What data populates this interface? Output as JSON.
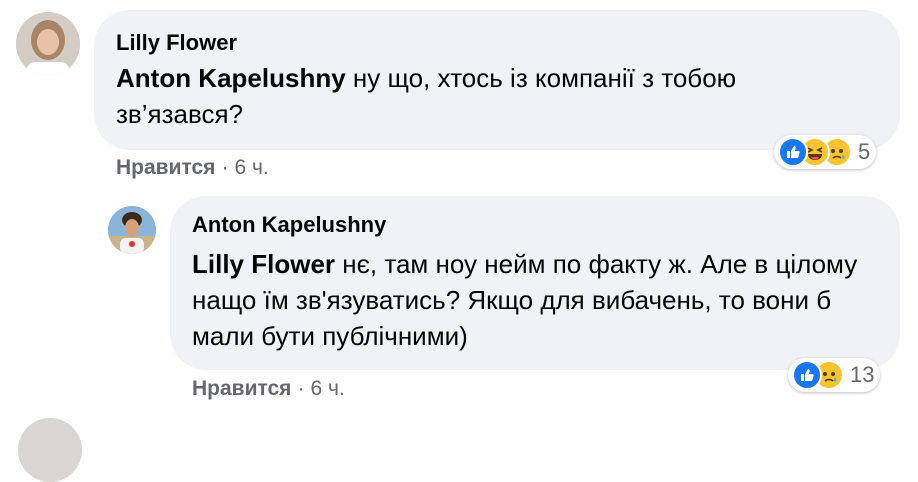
{
  "comment1": {
    "author": "Lilly Flower",
    "mention": "Anton Kapelushny",
    "text": " ну що, хтось із компанії з тобою зв’язався?",
    "like_label": "Нравится",
    "separator": "·",
    "time": "6 ч.",
    "reactions": [
      "like-icon",
      "haha-icon",
      "sad-icon"
    ],
    "reaction_count": "5"
  },
  "comment2": {
    "author": "Anton Kapelushny",
    "mention": "Lilly Flower",
    "text": " нє, там ноу нейм по факту ж. Але в цілому нащо їм зв'язуватись? Якщо для вибачень, то вони б мали бути публічними)",
    "like_label": "Нравится",
    "separator": "·",
    "time": "6 ч.",
    "reactions": [
      "like-icon",
      "sad-icon"
    ],
    "reaction_count": "13"
  },
  "colors": {
    "bubble": "#f0f2f5",
    "like_blue": "#1877f2",
    "emoji_yellow": "#f7c330",
    "meta_gray": "#65676b"
  }
}
